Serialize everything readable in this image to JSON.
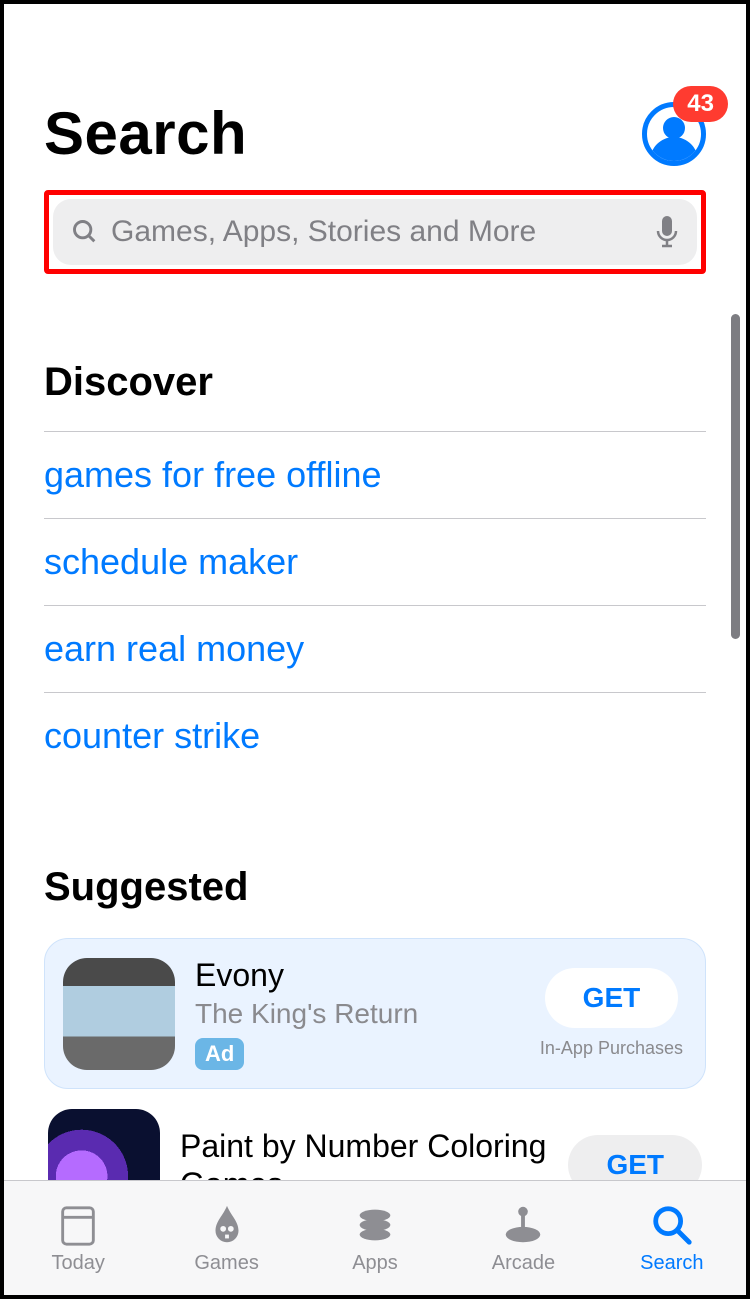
{
  "header": {
    "title": "Search",
    "badge_count": "43"
  },
  "search": {
    "placeholder": "Games, Apps, Stories and More"
  },
  "discover": {
    "heading": "Discover",
    "items": [
      "games for free offline",
      "schedule maker",
      "earn real money",
      "counter strike"
    ]
  },
  "suggested": {
    "heading": "Suggested",
    "apps": [
      {
        "name": "Evony",
        "subtitle": "The King's Return",
        "ad_label": "Ad",
        "action": "GET",
        "iap": "In-App Purchases"
      },
      {
        "name": "Paint by Number Coloring Games",
        "action": "GET"
      }
    ]
  },
  "tabs": {
    "today": "Today",
    "games": "Games",
    "apps": "Apps",
    "arcade": "Arcade",
    "search": "Search"
  }
}
